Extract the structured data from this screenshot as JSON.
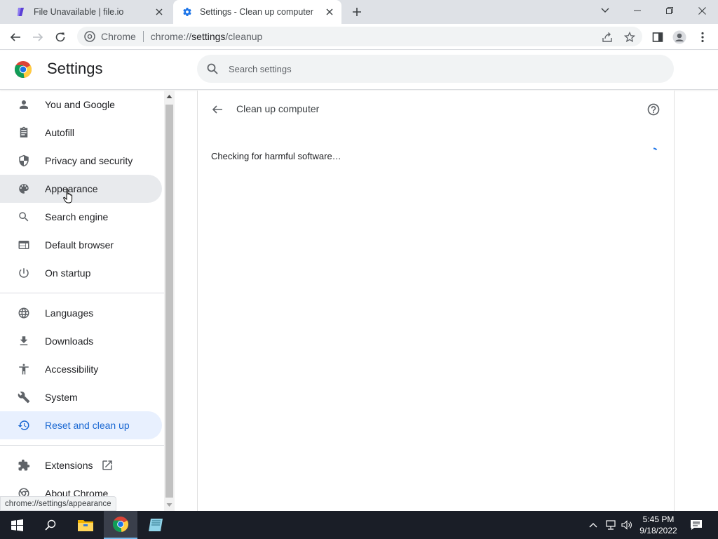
{
  "browser": {
    "tabs": [
      {
        "title": "File Unavailable | file.io",
        "favicon": "file-io-icon"
      },
      {
        "title": "Settings - Clean up computer",
        "favicon": "gear-icon"
      }
    ],
    "omnibox": {
      "site_label": "Chrome",
      "url_prefix": "chrome://",
      "url_host": "settings",
      "url_path": "/cleanup"
    },
    "status_url": "chrome://settings/appearance"
  },
  "settings": {
    "title": "Settings",
    "search_placeholder": "Search settings",
    "nav": [
      {
        "label": "You and Google",
        "icon": "person-icon"
      },
      {
        "label": "Autofill",
        "icon": "clipboard-icon"
      },
      {
        "label": "Privacy and security",
        "icon": "shield-icon"
      },
      {
        "label": "Appearance",
        "icon": "palette-icon",
        "state": "hover"
      },
      {
        "label": "Search engine",
        "icon": "search-icon"
      },
      {
        "label": "Default browser",
        "icon": "browser-window-icon"
      },
      {
        "label": "On startup",
        "icon": "power-icon"
      },
      {
        "label": "Languages",
        "icon": "globe-icon"
      },
      {
        "label": "Downloads",
        "icon": "download-icon"
      },
      {
        "label": "Accessibility",
        "icon": "accessibility-icon"
      },
      {
        "label": "System",
        "icon": "wrench-icon"
      },
      {
        "label": "Reset and clean up",
        "icon": "restore-icon",
        "state": "active"
      },
      {
        "label": "Extensions",
        "icon": "puzzle-icon"
      },
      {
        "label": "About Chrome",
        "icon": "chrome-icon"
      }
    ],
    "page": {
      "title": "Clean up computer",
      "status": "Checking for harmful software…"
    }
  },
  "taskbar": {
    "time": "5:45 PM",
    "date": "9/18/2022"
  },
  "colors": {
    "accent": "#1a73e8",
    "active_nav_bg": "#e8f0fe",
    "active_nav_text": "#1967d2",
    "tabstrip_bg": "#dee1e6",
    "taskbar_bg": "#1a1e27"
  }
}
